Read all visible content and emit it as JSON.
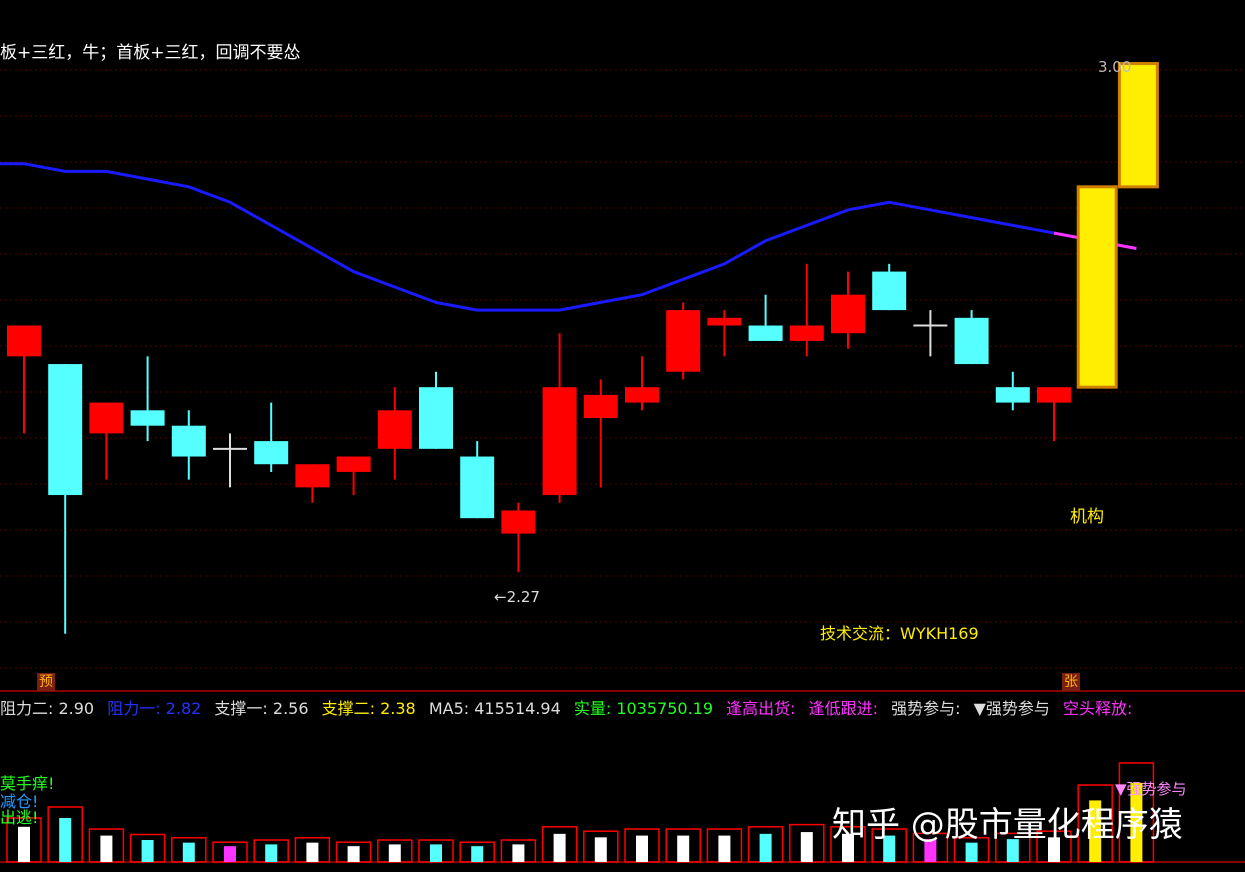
{
  "title": "板+三红，牛；首板+三红，回调不要怂",
  "badges": {
    "pre": "预",
    "rise": "张"
  },
  "price_annotations": {
    "high_label": "3.00",
    "low_label": "←2.27",
    "jigou": "机构",
    "contact": "技术交流：WYKH169"
  },
  "indicators": {
    "zuli2": "阻力二: 2.90",
    "zuli1": "阻力一: 2.82",
    "zhicheng1": "支撑一: 2.56",
    "zhicheng2": "支撑二: 2.38",
    "ma5": "MA5: 415514.94",
    "shiliang": "实量: 1035750.19",
    "fenggao": "逢高出货:",
    "fengdi": "逢低跟进:",
    "qiangshi": "强势参与:",
    "qiangshi_marker": "▼强势参与",
    "kongtou": "空头释放:"
  },
  "volume_labels": {
    "tag1": "莫手痒!",
    "tag2": "减仓!",
    "tag3": "出逃!",
    "right_marker": "▼强势参与"
  },
  "watermark": "知乎 @股市量化程序猿",
  "colors": {
    "up": "#ff0000",
    "down": "#55ffff",
    "limit": "#ffee00",
    "ma": "#1a1aff",
    "ma_alt": "#ff33ff",
    "grid": "#5a0000",
    "axis": "#b00000"
  },
  "chart_data": {
    "type": "candlestick",
    "ylim": [
      2.2,
      3.05
    ],
    "candles": [
      {
        "o": 2.62,
        "h": 2.65,
        "l": 2.52,
        "c": 2.66,
        "kind": "up"
      },
      {
        "o": 2.61,
        "h": 2.61,
        "l": 2.26,
        "c": 2.44,
        "kind": "down"
      },
      {
        "o": 2.52,
        "h": 2.55,
        "l": 2.46,
        "c": 2.56,
        "kind": "up"
      },
      {
        "o": 2.55,
        "h": 2.62,
        "l": 2.51,
        "c": 2.53,
        "kind": "down"
      },
      {
        "o": 2.53,
        "h": 2.55,
        "l": 2.46,
        "c": 2.49,
        "kind": "down"
      },
      {
        "o": 2.5,
        "h": 2.52,
        "l": 2.45,
        "c": 2.5,
        "kind": "doji"
      },
      {
        "o": 2.51,
        "h": 2.56,
        "l": 2.47,
        "c": 2.48,
        "kind": "down"
      },
      {
        "o": 2.45,
        "h": 2.48,
        "l": 2.43,
        "c": 2.48,
        "kind": "up"
      },
      {
        "o": 2.47,
        "h": 2.49,
        "l": 2.44,
        "c": 2.49,
        "kind": "up"
      },
      {
        "o": 2.5,
        "h": 2.58,
        "l": 2.46,
        "c": 2.55,
        "kind": "up"
      },
      {
        "o": 2.58,
        "h": 2.6,
        "l": 2.5,
        "c": 2.5,
        "kind": "down"
      },
      {
        "o": 2.49,
        "h": 2.51,
        "l": 2.41,
        "c": 2.41,
        "kind": "down"
      },
      {
        "o": 2.39,
        "h": 2.43,
        "l": 2.34,
        "c": 2.42,
        "kind": "up"
      },
      {
        "o": 2.44,
        "h": 2.65,
        "l": 2.43,
        "c": 2.58,
        "kind": "up"
      },
      {
        "o": 2.54,
        "h": 2.59,
        "l": 2.45,
        "c": 2.57,
        "kind": "up"
      },
      {
        "o": 2.56,
        "h": 2.62,
        "l": 2.55,
        "c": 2.58,
        "kind": "up"
      },
      {
        "o": 2.6,
        "h": 2.69,
        "l": 2.59,
        "c": 2.68,
        "kind": "up"
      },
      {
        "o": 2.66,
        "h": 2.68,
        "l": 2.62,
        "c": 2.67,
        "kind": "up"
      },
      {
        "o": 2.66,
        "h": 2.7,
        "l": 2.64,
        "c": 2.64,
        "kind": "down"
      },
      {
        "o": 2.64,
        "h": 2.74,
        "l": 2.62,
        "c": 2.66,
        "kind": "up"
      },
      {
        "o": 2.65,
        "h": 2.73,
        "l": 2.63,
        "c": 2.7,
        "kind": "up"
      },
      {
        "o": 2.73,
        "h": 2.74,
        "l": 2.68,
        "c": 2.68,
        "kind": "down"
      },
      {
        "o": 2.66,
        "h": 2.68,
        "l": 2.62,
        "c": 2.66,
        "kind": "doji"
      },
      {
        "o": 2.67,
        "h": 2.68,
        "l": 2.61,
        "c": 2.61,
        "kind": "down"
      },
      {
        "o": 2.58,
        "h": 2.6,
        "l": 2.55,
        "c": 2.56,
        "kind": "down"
      },
      {
        "o": 2.56,
        "h": 2.58,
        "l": 2.51,
        "c": 2.58,
        "kind": "up"
      },
      {
        "o": 2.58,
        "h": 2.84,
        "l": 2.58,
        "c": 2.84,
        "kind": "limit"
      },
      {
        "o": 2.84,
        "h": 3.0,
        "l": 2.84,
        "c": 3.0,
        "kind": "limit"
      }
    ],
    "ma": [
      2.87,
      2.86,
      2.86,
      2.85,
      2.84,
      2.82,
      2.79,
      2.76,
      2.73,
      2.71,
      2.69,
      2.68,
      2.68,
      2.68,
      2.69,
      2.7,
      2.72,
      2.74,
      2.77,
      2.79,
      2.81,
      2.82,
      2.81,
      2.8,
      2.79,
      2.78,
      2.77,
      2.76
    ],
    "volumes": [
      0.4,
      0.5,
      0.3,
      0.25,
      0.22,
      0.18,
      0.2,
      0.22,
      0.18,
      0.2,
      0.2,
      0.18,
      0.2,
      0.32,
      0.28,
      0.3,
      0.3,
      0.3,
      0.32,
      0.34,
      0.32,
      0.3,
      0.26,
      0.22,
      0.26,
      0.28,
      0.7,
      0.9
    ]
  }
}
